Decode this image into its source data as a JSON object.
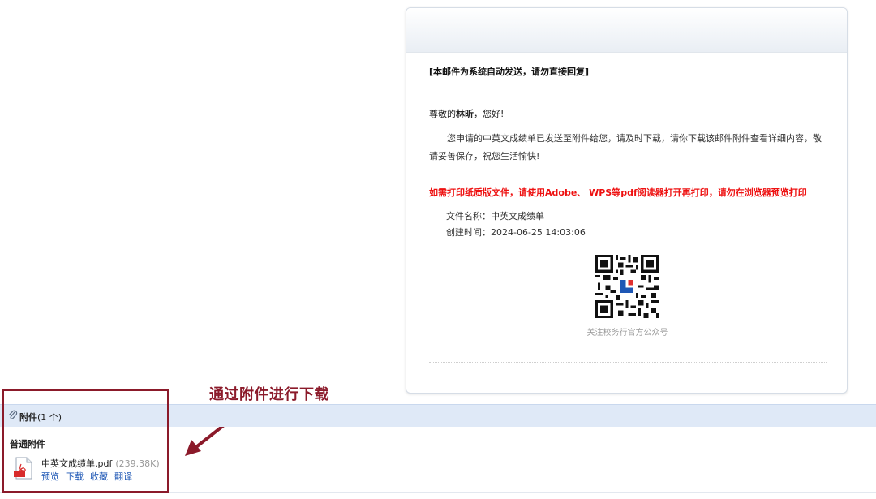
{
  "email": {
    "auto_note": "[本邮件为系统自动发送，请勿直接回复]",
    "greeting_prefix": "尊敬的",
    "recipient_name": "林昕",
    "greeting_suffix": "，您好!",
    "body": "您申请的中英文成绩单已发送至附件给您，请及时下载，请你下载该邮件附件查看详细内容，敬请妥善保存，祝您生活愉快!",
    "warning": "如需打印纸质版文件，请使用Adobe、 WPS等pdf阅读器打开再打印，请勿在浏览器预览打印",
    "file_name_line": "文件名称：中英文成绩单",
    "created_line": "创建时间：2024-06-25 14:03:06",
    "qr_caption": "关注校务行官方公众号"
  },
  "annotation": {
    "text": "通过附件进行下载",
    "color": "#8b1a2a"
  },
  "attachments": {
    "title": "附件",
    "count": "(1 个)",
    "section_label": "普通附件",
    "files": [
      {
        "name": "中英文成绩单.pdf",
        "size": "(239.38K)",
        "actions": [
          "预览",
          "下载",
          "收藏",
          "翻译"
        ]
      }
    ]
  },
  "colors": {
    "warning": "#ee1111",
    "link": "#1e57b5",
    "bar": "#dfe9f7"
  }
}
